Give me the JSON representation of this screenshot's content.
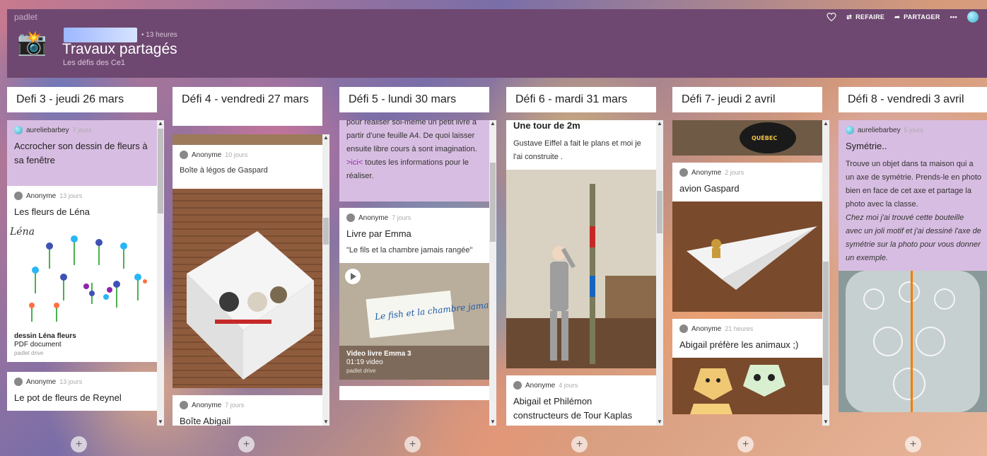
{
  "app": {
    "brand": "padlet",
    "author_time": "• 13 heures",
    "title": "Travaux partagés",
    "subtitle": "Les défis des Ce1"
  },
  "actions": {
    "remake": "REFAIRE",
    "share": "PARTAGER",
    "more": "•••"
  },
  "columns": [
    {
      "title": "Defi 3 - jeudi 26 mars",
      "cards": [
        {
          "author": "aureliebarbey",
          "ago": "7 jours",
          "title": "Accrocher son dessin de fleurs à sa fenêtre"
        },
        {
          "author": "Anonyme",
          "ago": "13 jours",
          "title": "Les fleurs de Léna",
          "attachment": {
            "name": "dessin Léna fleurs",
            "type": "PDF document",
            "source": "padlet drive"
          },
          "handwriting": "Léna"
        },
        {
          "author": "Anonyme",
          "ago": "13 jours",
          "title": "Le pot de fleurs de Reynel"
        }
      ]
    },
    {
      "title": "Défi 4 - vendredi 27 mars",
      "cards": [
        {
          "author": "Anonyme",
          "ago": "10 jours",
          "text": "Boîte à légos de Gaspard"
        },
        {
          "author": "Anonyme",
          "ago": "7 jours",
          "title": "Boîte Abigail"
        }
      ]
    },
    {
      "title": "Défi 5 - lundi 30 mars",
      "cards": [
        {
          "text_before": "pour réaliser soi-même un petit livre à partir d'une feuille A4. De quoi laisser ensuite libre cours à sont imagination.",
          "link": ">ici<",
          "text_after": " toutes les informations pour le réaliser."
        },
        {
          "author": "Anonyme",
          "ago": "7 jours",
          "title": "Livre par Emma",
          "text": "\"Le fils et la chambre jamais rangée\"",
          "attachment": {
            "name": "Video livre Emma 3",
            "type": "01:19 video",
            "source": "padlet drive"
          },
          "handwriting": "Le fish et la chambre jamais rangée!!!"
        }
      ]
    },
    {
      "title": "Défi 6 - mardi 31 mars",
      "cards": [
        {
          "title": "Une tour de 2m",
          "text": "Gustave Eiffel a fait le plans et moi je l'ai construite ."
        },
        {
          "author": "Anonyme",
          "ago": "4 jours",
          "title": "Abigail et Philémon constructeurs de Tour Kaplas"
        }
      ]
    },
    {
      "title": "Défi 7- jeudi 2 avril",
      "cards": [
        {
          "author": "Anonyme",
          "ago": "2 jours",
          "title": "avion Gaspard",
          "cap_text": "QUÉBEC"
        },
        {
          "author": "Anonyme",
          "ago": "21 heures",
          "title": "Abigail préfère les animaux ;)"
        }
      ]
    },
    {
      "title": "Défi 8 - vendredi 3 avril",
      "cards": [
        {
          "author": "aureliebarbey",
          "ago": "5 jours",
          "title": "Symétrie..",
          "text": "Trouve un objet dans ta maison qui a un axe de symétrie. Prends-le en photo bien en face de cet axe et partage la photo avec la classe.",
          "italic": "Chez moi j'ai trouvé cette bouteille avec un joli motif et j'ai dessiné l'axe de symétrie sur la photo pour vous donner un exemple."
        }
      ]
    }
  ],
  "add_label": "+"
}
